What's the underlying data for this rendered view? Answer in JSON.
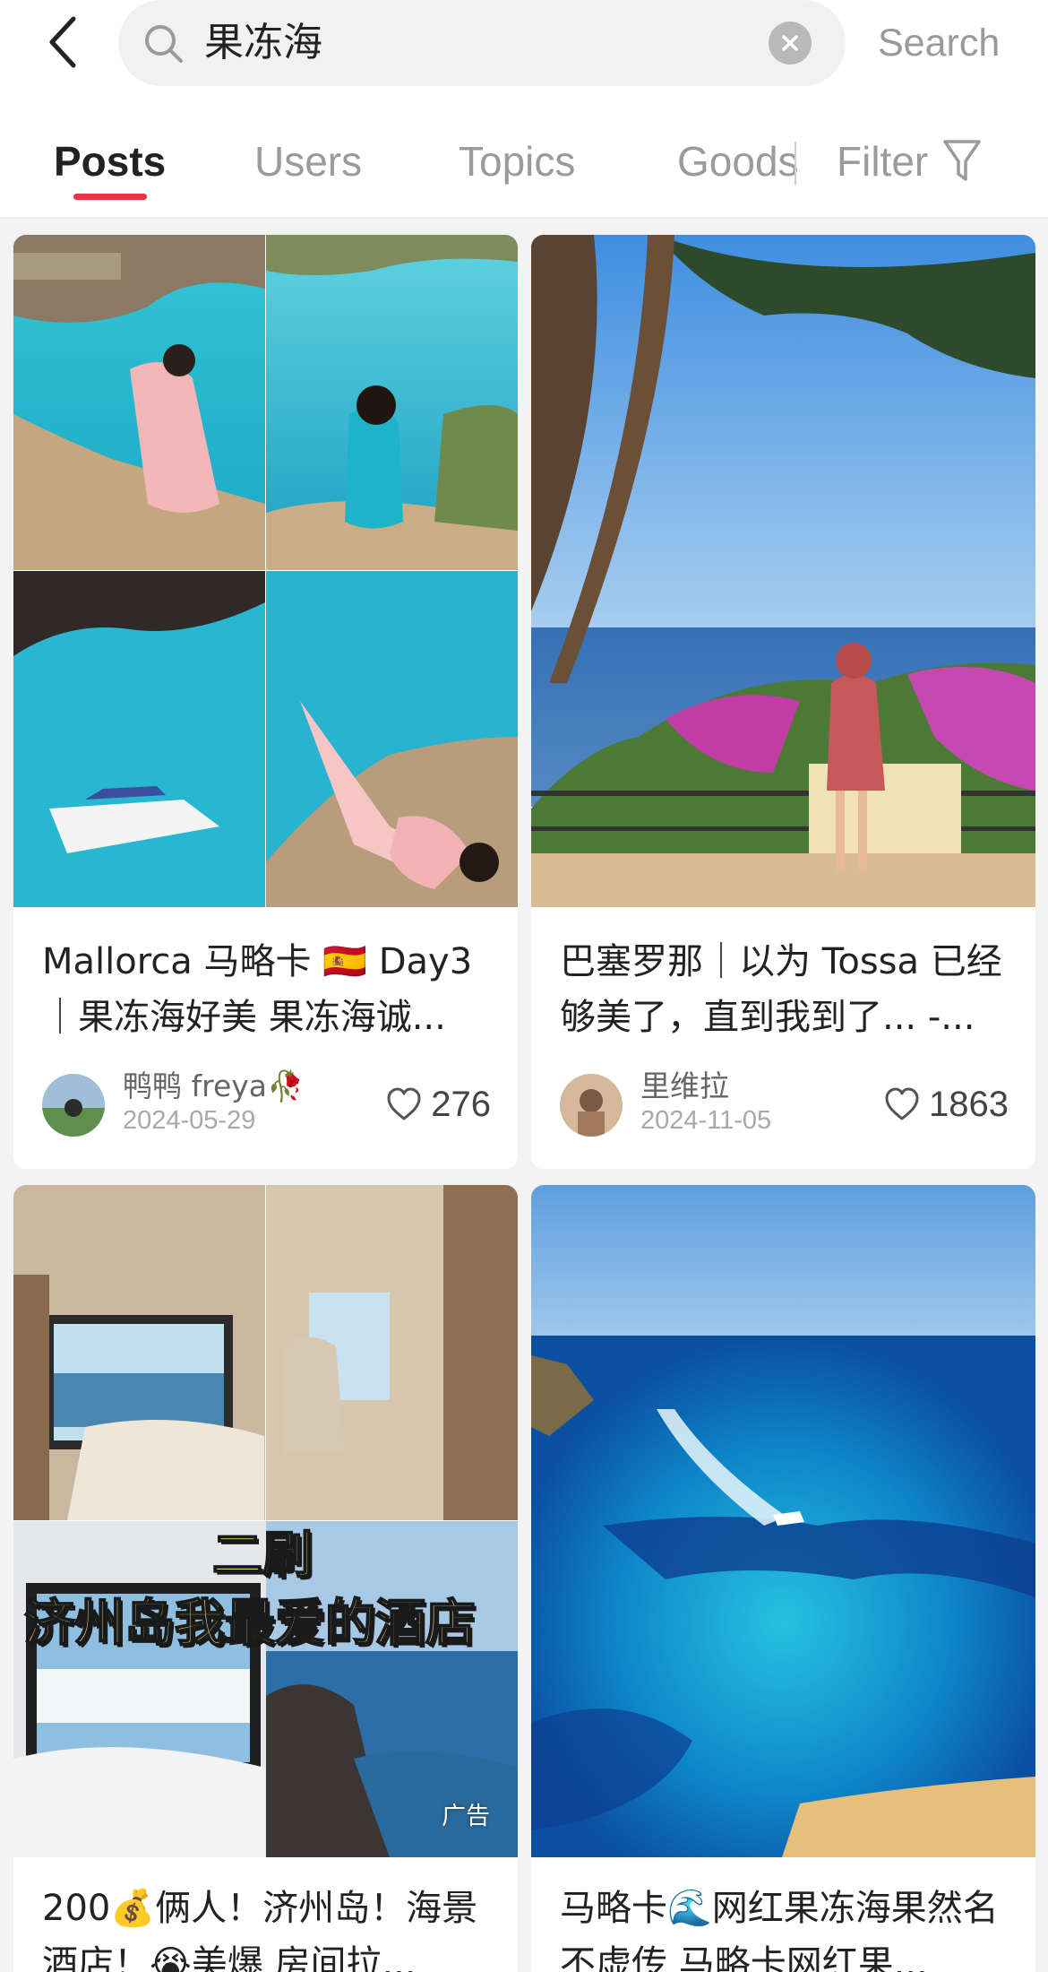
{
  "search": {
    "query": "果冻海",
    "button_label": "Search"
  },
  "tabs": [
    {
      "label": "Posts",
      "active": true
    },
    {
      "label": "Users",
      "active": false
    },
    {
      "label": "Topics",
      "active": false
    },
    {
      "label": "Goods",
      "active": false
    }
  ],
  "filter": {
    "label": "Filter"
  },
  "colors": {
    "accent": "#e8334a"
  },
  "posts": [
    {
      "title": "Mallorca 马略卡 🇪🇸 Day3 ｜果冻海好美 果冻海诚...",
      "author": "鸭鸭 freya🥀",
      "date": "2024-05-29",
      "likes": "276"
    },
    {
      "title": "巴塞罗那｜以为 Tossa 已经够美了，直到我到了... -...",
      "author": "里维拉",
      "date": "2024-11-05",
      "likes": "1863"
    },
    {
      "title": "200💰俩人！济州岛！海景酒店！😭美爆 房间拉...",
      "overlay_line1": "二刷",
      "overlay_line2": "济州岛我最爱的酒店",
      "ad_label": "广告"
    },
    {
      "title": "马略卡🌊网红果冻海果然名不虚传 马略卡网红果..."
    }
  ]
}
